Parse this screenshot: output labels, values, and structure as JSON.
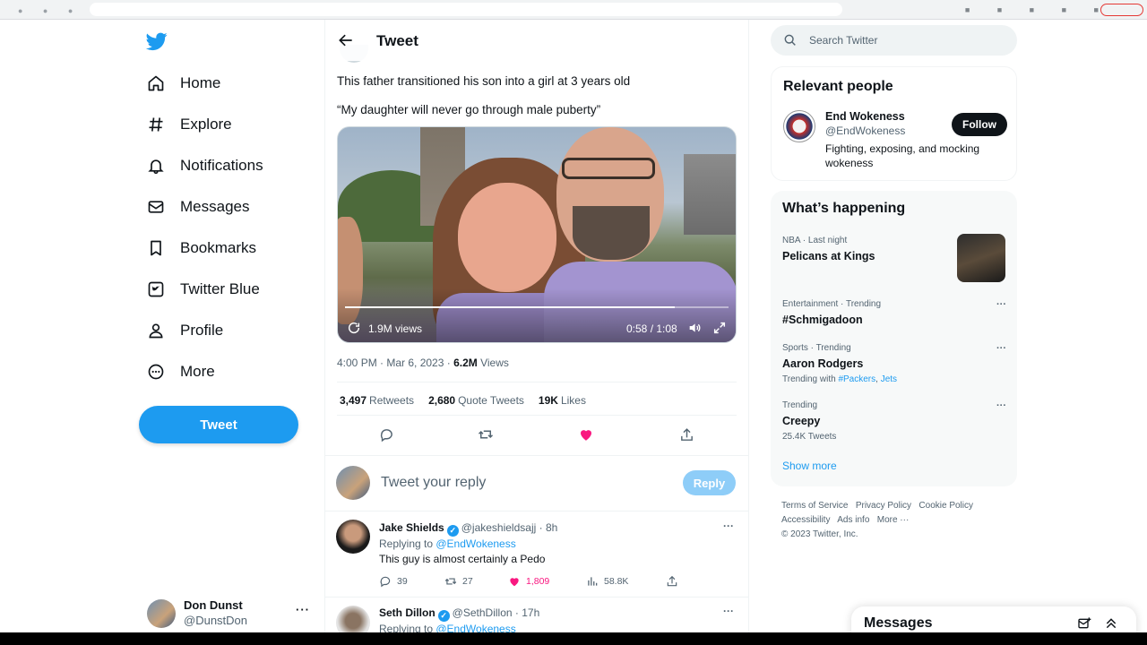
{
  "nav": {
    "items": [
      {
        "label": "Home",
        "icon": "home-icon"
      },
      {
        "label": "Explore",
        "icon": "hashtag-icon"
      },
      {
        "label": "Notifications",
        "icon": "bell-icon"
      },
      {
        "label": "Messages",
        "icon": "envelope-icon"
      },
      {
        "label": "Bookmarks",
        "icon": "bookmark-icon"
      },
      {
        "label": "Twitter Blue",
        "icon": "twitter-blue-icon"
      },
      {
        "label": "Profile",
        "icon": "person-icon"
      },
      {
        "label": "More",
        "icon": "more-circle-icon"
      }
    ],
    "tweet_button": "Tweet"
  },
  "account": {
    "name": "Don Dunst",
    "handle": "@DunstDon",
    "more": "···"
  },
  "center": {
    "title": "Tweet",
    "tweet": {
      "line1": "This father transitioned his son into a girl at 3 years old",
      "line2": "“My daughter will never go through male puberty”",
      "video": {
        "views": "1.9M views",
        "time": "0:58 / 1:08",
        "progress": 0.86
      },
      "timestamp": "4:00 PM · Mar 6, 2023 · ",
      "views_count": "6.2M",
      "views_label": " Views",
      "stats": {
        "retweets": "3,497",
        "retweets_label": "Retweets",
        "quotes": "2,680",
        "quotes_label": "Quote Tweets",
        "likes": "19K",
        "likes_label": "Likes"
      }
    },
    "reply_box": {
      "placeholder": "Tweet your reply",
      "button": "Reply"
    },
    "replies": [
      {
        "name": "Jake Shields",
        "handle": "@jakeshieldsajj · 8h",
        "replying_to_prefix": "Replying to ",
        "replying_to": "@EndWokeness",
        "text": "This guy is almost certainly a Pedo",
        "replies": "39",
        "retweets": "27",
        "likes": "1,809",
        "views": "58.8K"
      },
      {
        "name": "Seth Dillon",
        "handle": "@SethDillon · 17h",
        "replying_to_prefix": "Replying to ",
        "replying_to": "@EndWokeness"
      }
    ]
  },
  "right": {
    "search_placeholder": "Search Twitter",
    "relevant": {
      "title": "Relevant people",
      "name": "End Wokeness",
      "handle": "@EndWokeness",
      "bio": "Fighting, exposing, and mocking wokeness",
      "follow": "Follow"
    },
    "happening": {
      "title": "What’s happening",
      "trends": [
        {
          "meta": "NBA · Last night",
          "title": "Pelicans at Kings"
        },
        {
          "meta": "Entertainment · Trending",
          "title": "#Schmigadoon"
        },
        {
          "meta": "Sports · Trending",
          "title": "Aaron Rodgers",
          "sub_prefix": "Trending with ",
          "sub_link1": "#Packers",
          "sub_sep": ", ",
          "sub_link2": "Jets"
        },
        {
          "meta": "Trending",
          "title": "Creepy",
          "sub": "25.4K Tweets"
        }
      ],
      "show_more": "Show more"
    },
    "footer": {
      "line1": [
        "Terms of Service",
        "Privacy Policy",
        "Cookie Policy"
      ],
      "line2": [
        "Accessibility",
        "Ads info",
        "More ···"
      ],
      "copyright": "© 2023 Twitter, Inc."
    },
    "messages_drawer": "Messages"
  },
  "colors": {
    "accent": "#1d9bf0",
    "like": "#f91880",
    "text": "#0f1419",
    "muted": "#536471"
  }
}
